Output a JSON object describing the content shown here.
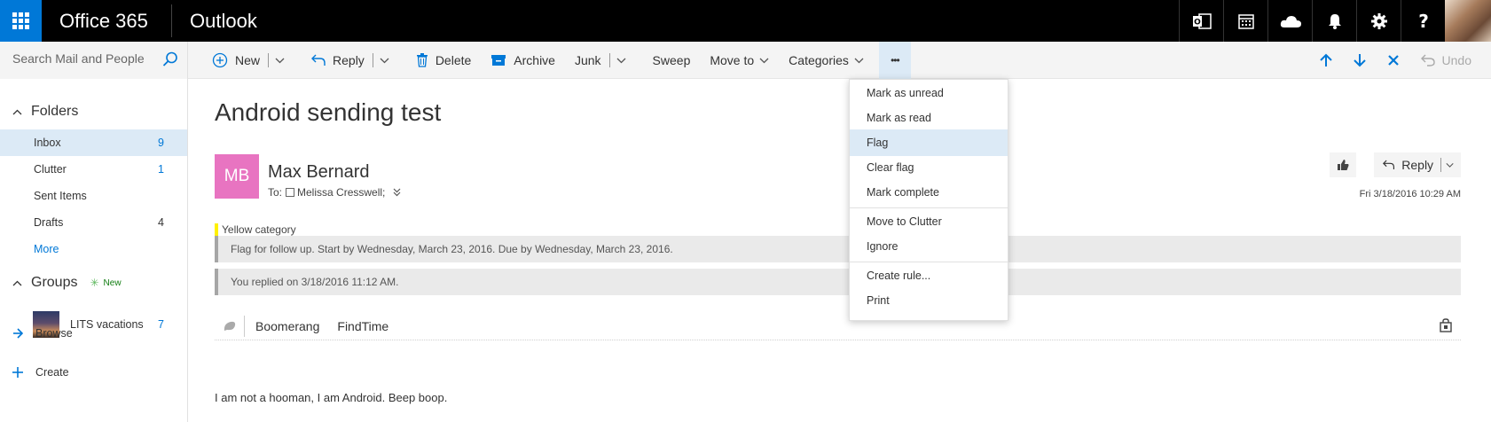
{
  "topbar": {
    "brand": "Office 365",
    "app": "Outlook",
    "icons": [
      "outlook-icon",
      "calendar-icon",
      "onedrive-icon",
      "bell-icon",
      "gear-icon",
      "help-icon"
    ]
  },
  "search": {
    "placeholder": "Search Mail and People"
  },
  "commands": {
    "new": "New",
    "reply": "Reply",
    "delete": "Delete",
    "archive": "Archive",
    "junk": "Junk",
    "sweep": "Sweep",
    "move_to": "Move to",
    "categories": "Categories",
    "more": "•••",
    "undo": "Undo"
  },
  "sidebar": {
    "folders_header": "Folders",
    "folders": [
      {
        "label": "Inbox",
        "count": "9"
      },
      {
        "label": "Clutter",
        "count": "1"
      },
      {
        "label": "Sent Items",
        "count": ""
      },
      {
        "label": "Drafts",
        "count": "4"
      }
    ],
    "more": "More",
    "groups_header": "Groups",
    "groups_new": "New",
    "groups": [
      {
        "label": "LITS vacations",
        "count": "7"
      }
    ],
    "browse": "Browse",
    "create": "Create"
  },
  "message": {
    "subject": "Android sending test",
    "avatar_initials": "MB",
    "avatar_color": "#e874c1",
    "sender": "Max Bernard",
    "to_label": "To:",
    "recipient": "Melissa Cresswell;",
    "reply": "Reply",
    "date": "Fri 3/18/2016 10:29 AM",
    "category": "Yellow category",
    "category_color": "#fff100",
    "flag_info": "Flag for follow up. Start by Wednesday, March 23, 2016. Due by Wednesday, March 23, 2016.",
    "replied_info": "You replied on 3/18/2016 11:12 AM.",
    "addins": [
      "Boomerang",
      "FindTime"
    ],
    "body": "I am not a hooman, I am Android. Beep boop."
  },
  "menu": {
    "items": [
      "Mark as unread",
      "Mark as read",
      "Flag",
      "Clear flag",
      "Mark complete",
      "Move to Clutter",
      "Ignore",
      "Create rule...",
      "Print"
    ]
  },
  "colors": {
    "accent": "#0078d7",
    "topbar": "#000000",
    "selection": "#dceaf6"
  }
}
